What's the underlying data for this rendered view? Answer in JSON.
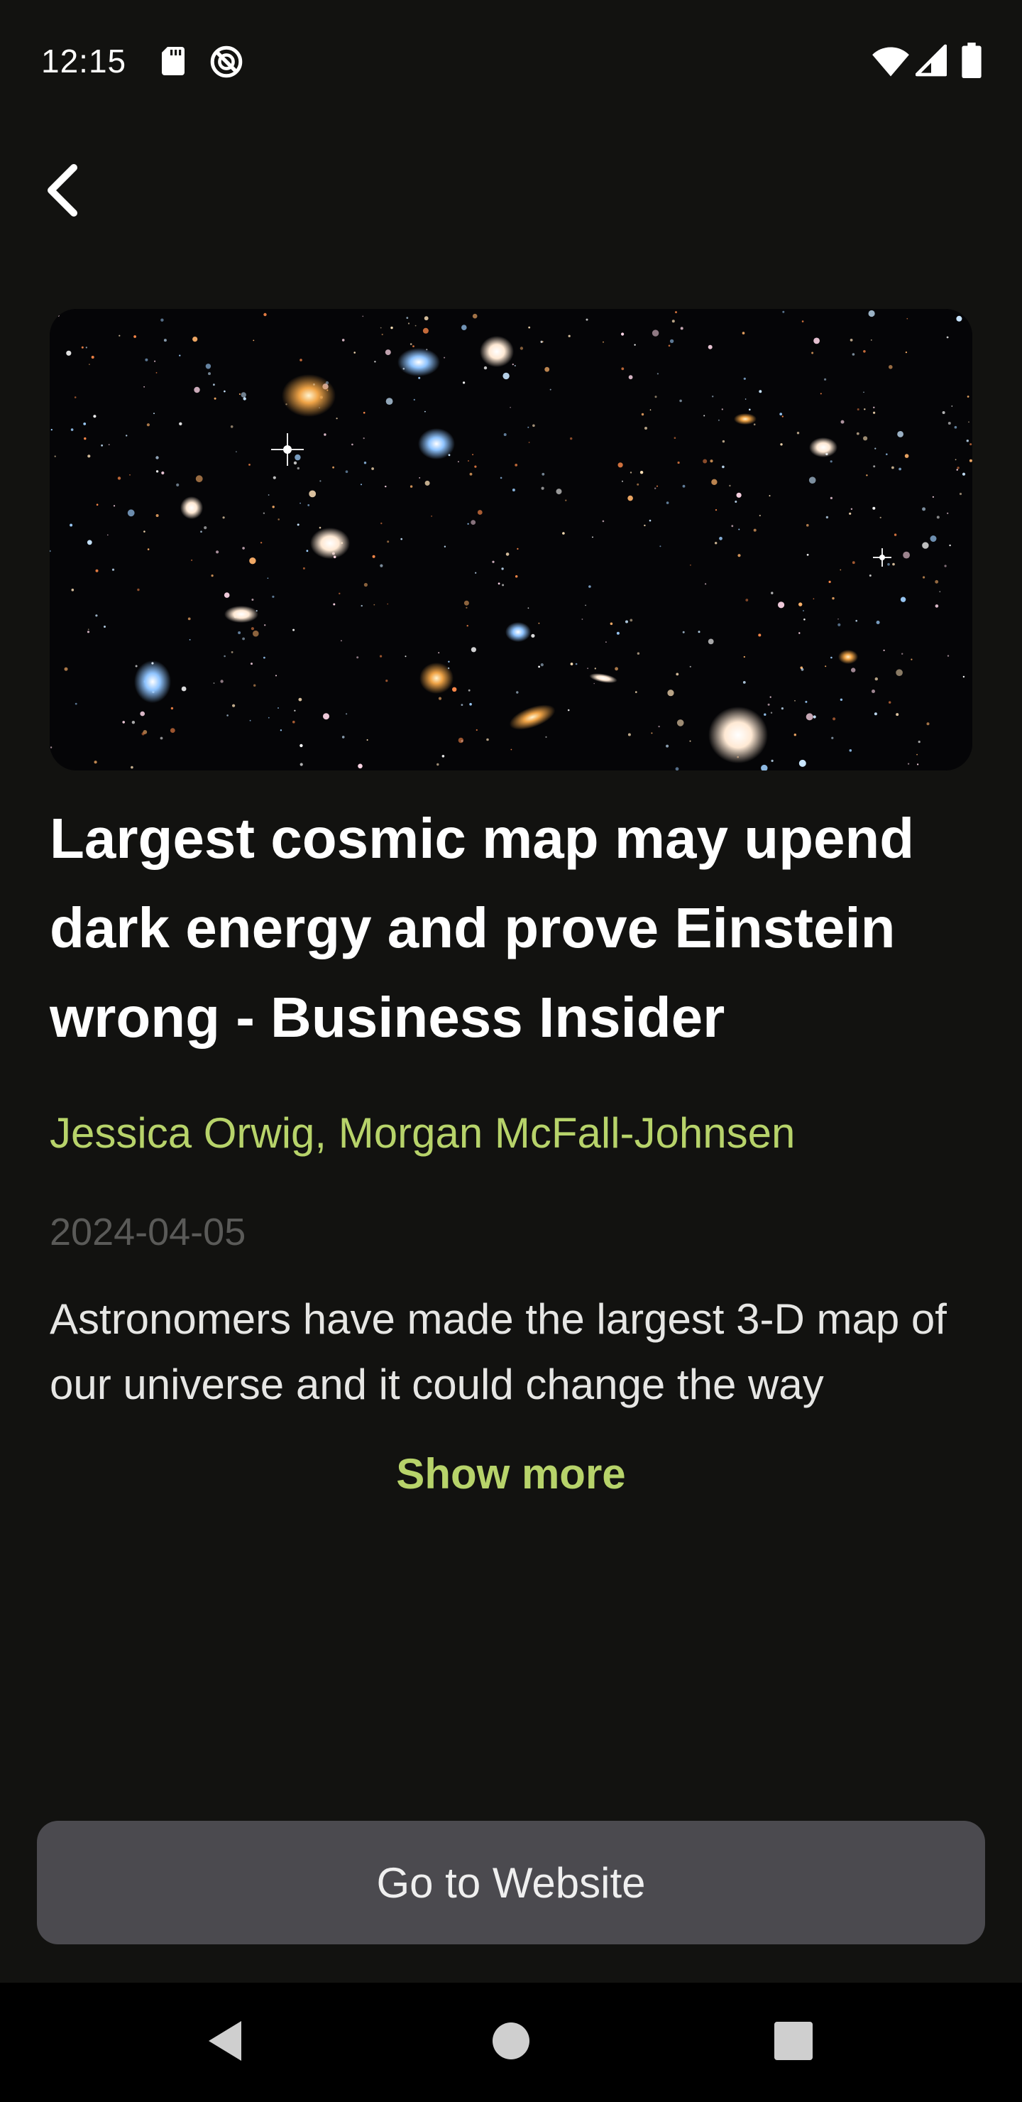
{
  "status_bar": {
    "time": "12:15",
    "left_icons": [
      "sd-card-icon",
      "do-not-disturb-icon"
    ],
    "right_icons": [
      "wifi-icon",
      "cellular-signal-icon",
      "battery-icon"
    ]
  },
  "toolbar": {
    "back_icon": "back-arrow-icon"
  },
  "article": {
    "headline": "Largest cosmic map may upend dark energy and prove Einstein wrong - Business Insider",
    "authors": "Jessica Orwig, Morgan McFall-Johnsen",
    "date": "2024-04-05",
    "summary": "Astronomers have made the largest 3-D map of our universe and it could change the way",
    "show_more_label": "Show more"
  },
  "actions": {
    "go_to_website_label": "Go to Website"
  },
  "colors": {
    "background": "#121210",
    "accent": "#b7d36a",
    "date_text": "#5a5a58",
    "button_bg": "#4b4a4f"
  },
  "nav_bar": {
    "buttons": [
      "nav-back-icon",
      "nav-home-icon",
      "nav-recents-icon"
    ]
  }
}
